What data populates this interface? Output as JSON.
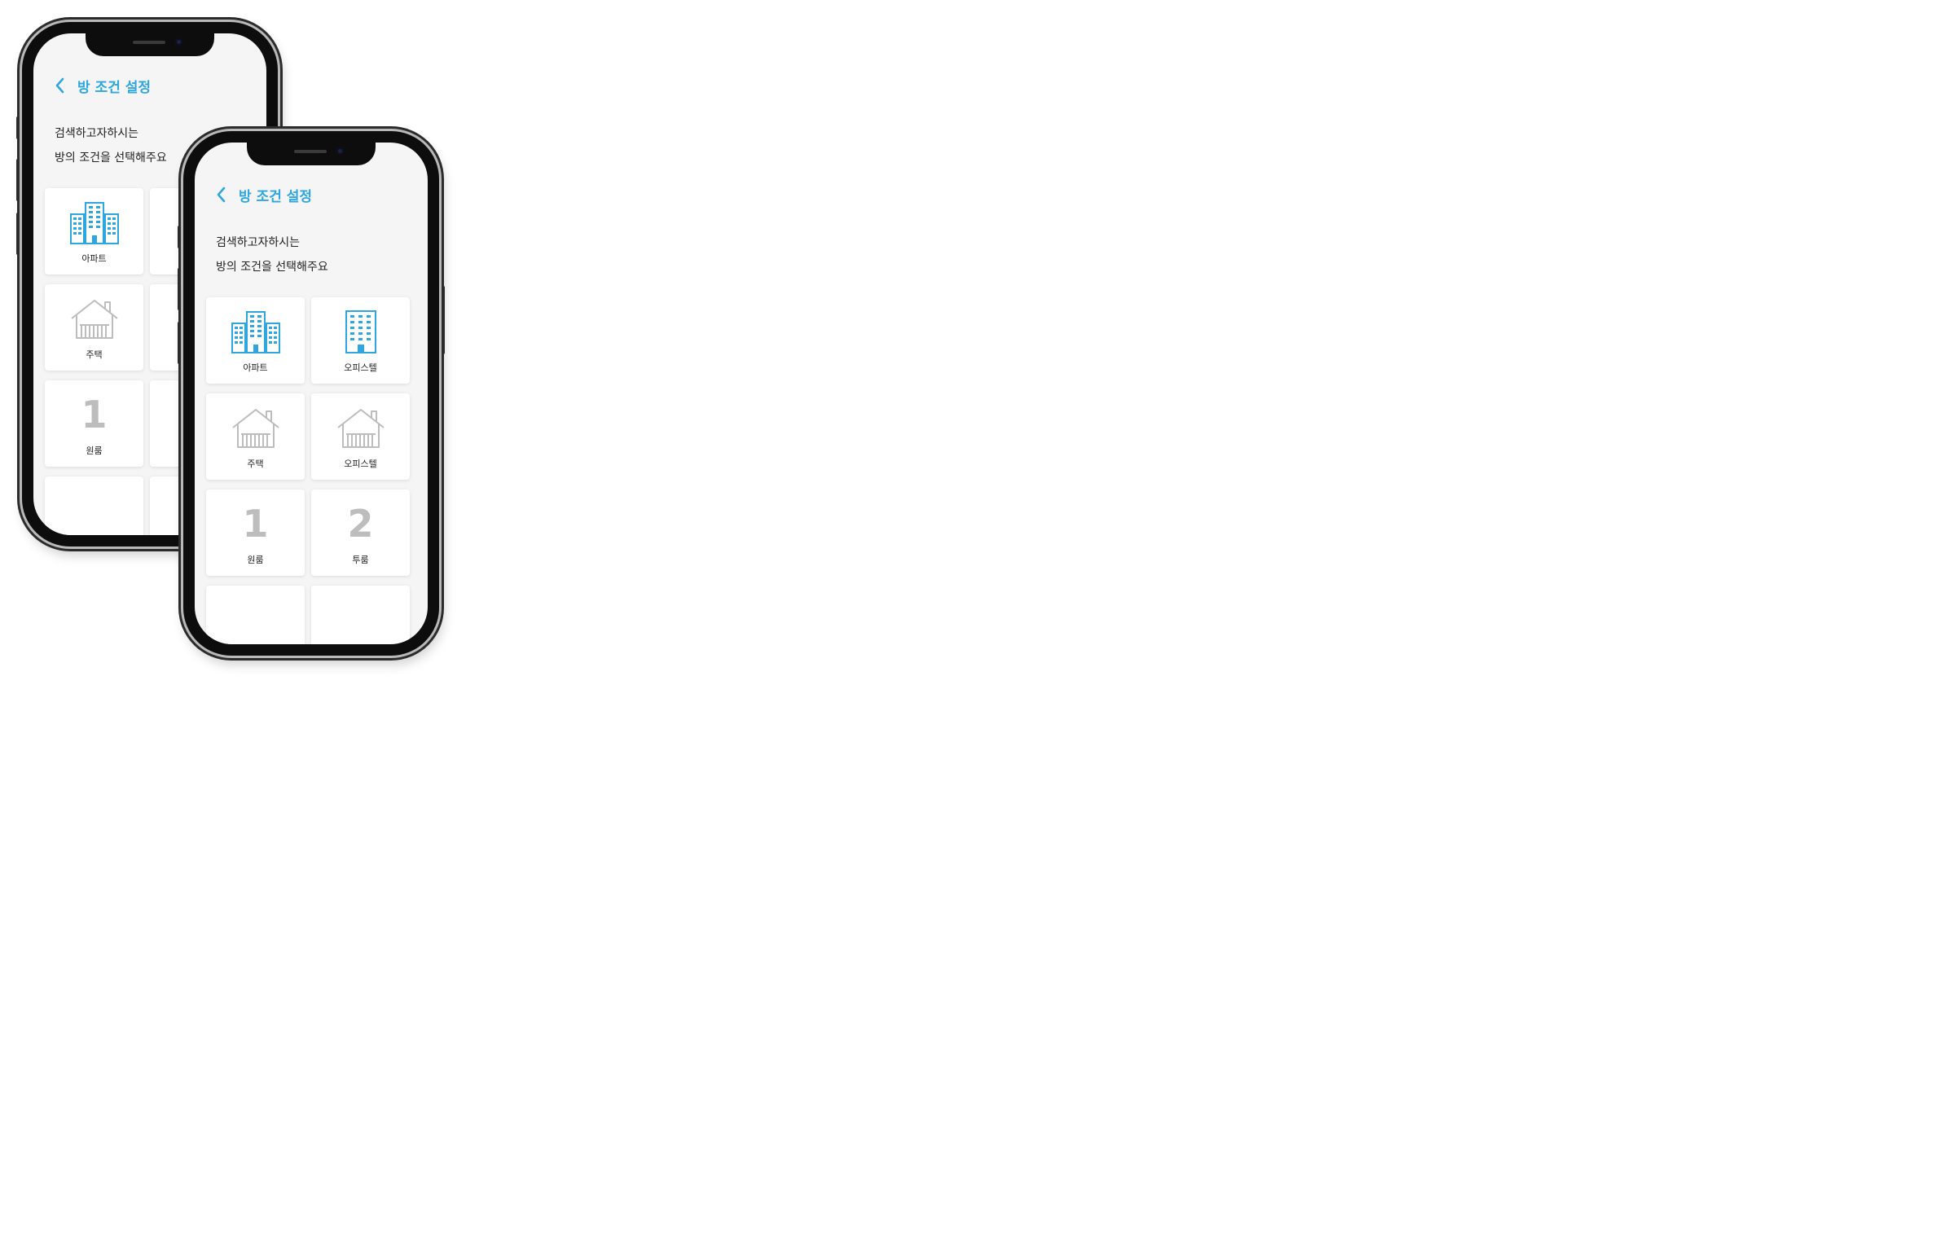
{
  "colors": {
    "accent": "#2ea7e0",
    "inactive_icon": "#bdbdbd",
    "screen_bg": "#f5f5f5",
    "card_bg": "#ffffff"
  },
  "back_phone": {
    "header": {
      "back_icon": "chevron-left-icon",
      "title": "방 조건 설정"
    },
    "prompt": {
      "line1": "검색하고자하시는",
      "line2": "방의 조건을 선택해주요"
    },
    "cards": [
      {
        "label": "아파트",
        "icon": "apartment-building-icon"
      },
      {
        "label": "",
        "icon": ""
      },
      {
        "label": "주택",
        "icon": "house-icon"
      },
      {
        "label": "",
        "icon": ""
      },
      {
        "label": "원룸",
        "number": "1"
      },
      {
        "label": "",
        "number": ""
      },
      {
        "label": "",
        "icon": ""
      },
      {
        "label": "",
        "icon": ""
      }
    ]
  },
  "front_phone": {
    "header": {
      "back_icon": "chevron-left-icon",
      "title": "방 조건 설정"
    },
    "prompt": {
      "line1": "검색하고자하시는",
      "line2": "방의 조건을 선택해주요"
    },
    "cards": [
      {
        "label": "아파트",
        "icon": "apartment-building-icon"
      },
      {
        "label": "오피스텔",
        "icon": "office-building-icon"
      },
      {
        "label": "주택",
        "icon": "house-icon"
      },
      {
        "label": "오피스텔",
        "icon": "house-icon"
      },
      {
        "label": "원룸",
        "number": "1"
      },
      {
        "label": "투룸",
        "number": "2"
      },
      {
        "label": "",
        "icon": ""
      },
      {
        "label": "",
        "icon": ""
      }
    ]
  }
}
